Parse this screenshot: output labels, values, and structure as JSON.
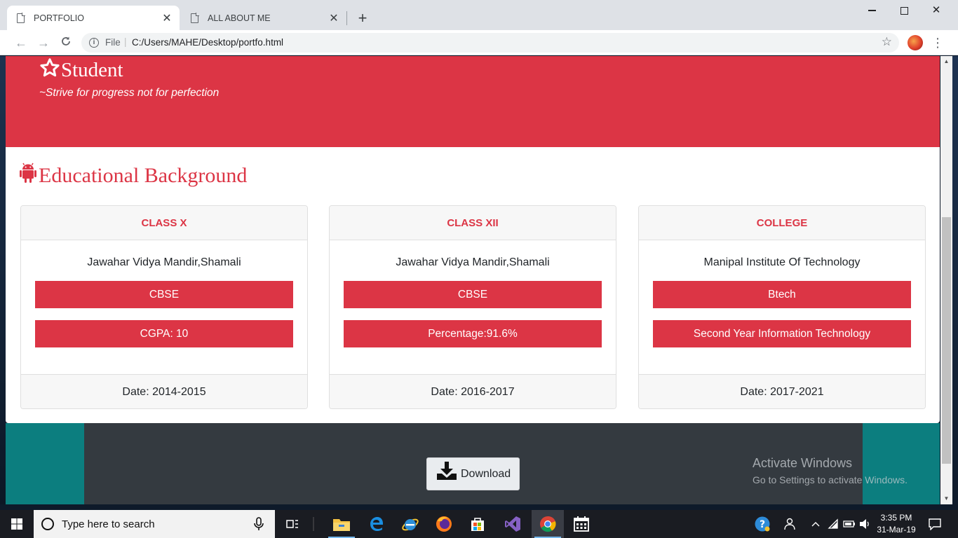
{
  "browser": {
    "tabs": [
      {
        "title": "PORTFOLIO",
        "active": true
      },
      {
        "title": "ALL ABOUT ME",
        "active": false
      }
    ],
    "new_tab": "+",
    "address": {
      "scheme": "File",
      "url": "C:/Users/MAHE/Desktop/portfo.html"
    }
  },
  "hero": {
    "title": "Student",
    "quote": "~Strive for progress not for perfection"
  },
  "education": {
    "title": "Educational Background",
    "cards": [
      {
        "header": "CLASS X",
        "school": "Jawahar Vidya Mandir,Shamali",
        "board": "CBSE",
        "score": "CGPA: 10",
        "date": "Date: 2014-2015"
      },
      {
        "header": "CLASS XII",
        "school": "Jawahar Vidya Mandir,Shamali",
        "board": "CBSE",
        "score": "Percentage:91.6%",
        "date": "Date: 2016-2017"
      },
      {
        "header": "COLLEGE",
        "school": "Manipal Institute Of Technology",
        "board": "Btech",
        "score": "Second Year Information Technology",
        "date": "Date: 2017-2021"
      }
    ]
  },
  "footer": {
    "download_label": "Download"
  },
  "watermark": {
    "line1": "Activate Windows",
    "line2": "Go to Settings to activate Windows."
  },
  "taskbar": {
    "search_placeholder": "Type here to search",
    "time": "3:35 PM",
    "date": "31-Mar-19"
  },
  "colors": {
    "accent": "#dc3545",
    "teal": "#0c7e7f",
    "dark": "#343a40"
  }
}
